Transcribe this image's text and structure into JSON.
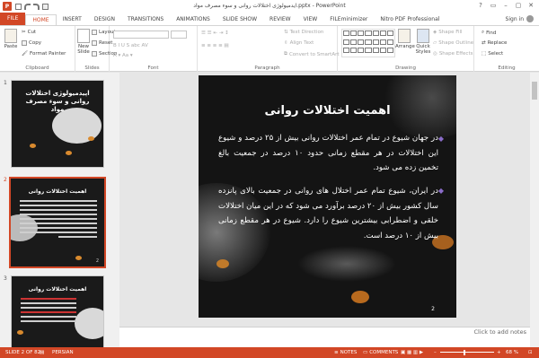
{
  "app": {
    "title": "ایدمیولوژی اختلالات روانی و سوء مصرف مواد.pptx - PowerPoint",
    "sign_in": "Sign in"
  },
  "tabs": [
    "FILE",
    "HOME",
    "INSERT",
    "DESIGN",
    "TRANSITIONS",
    "ANIMATIONS",
    "SLIDE SHOW",
    "REVIEW",
    "VIEW",
    "FILEminimizer",
    "Nitro PDF Professional"
  ],
  "active_tab": "HOME",
  "ribbon": {
    "clipboard": {
      "label": "Clipboard",
      "paste": "Paste",
      "cut": "Cut",
      "copy": "Copy",
      "format_painter": "Format Painter"
    },
    "slides": {
      "label": "Slides",
      "new_slide": "New Slide",
      "layout": "Layout",
      "reset": "Reset",
      "section": "Section"
    },
    "font": {
      "label": "Font"
    },
    "paragraph": {
      "label": "Paragraph",
      "text_direction": "Text Direction",
      "align_text": "Align Text",
      "convert_smartart": "Convert to SmartArt"
    },
    "drawing": {
      "label": "Drawing",
      "arrange": "Arrange",
      "quick_styles": "Quick Styles",
      "shape_fill": "Shape Fill",
      "shape_outline": "Shape Outline",
      "shape_effects": "Shape Effects"
    },
    "editing": {
      "label": "Editing",
      "find": "Find",
      "replace": "Replace",
      "select": "Select"
    }
  },
  "thumbnails": [
    {
      "number": "1",
      "title": "اپیدمیولوژی اختلالات روانی و سوء مصرف مواد"
    },
    {
      "number": "2",
      "title": "اهمیت اختلالات روانی",
      "slide_no": "2"
    },
    {
      "number": "3",
      "title": "اهمیت اختلالات روانی"
    }
  ],
  "slide": {
    "title": "اهمیت اختلالات روانی",
    "bullet1": "در جهان شیوع در تمام عمر اختلالات روانی بیش از ۲۵ درصد و شیوع این اختلالات در هر مقطع زمانی حدود ۱۰ درصد در جمعیت بالغ تخمین زده می شود.",
    "bullet2": "در ایران، شیوع تمام عمر اختلال های روانی در جمعیت بالای پانزده سال کشور بیش از ۲۰ درصد برآورد می شود که در این میان اختلالات خلقی و اضطرابی بیشترین شیوع را دارد. شیوع در هر مقطع زمانی بیش از ۱۰ درصد است.",
    "number": "2"
  },
  "notes_placeholder": "Click to add notes",
  "status": {
    "slide_info": "SLIDE 2 OF 82",
    "language": "PERSIAN",
    "notes": "NOTES",
    "comments": "COMMENTS",
    "zoom": "68 %"
  },
  "colors": {
    "accent": "#d24726",
    "bullet": "#8a6cc9"
  }
}
